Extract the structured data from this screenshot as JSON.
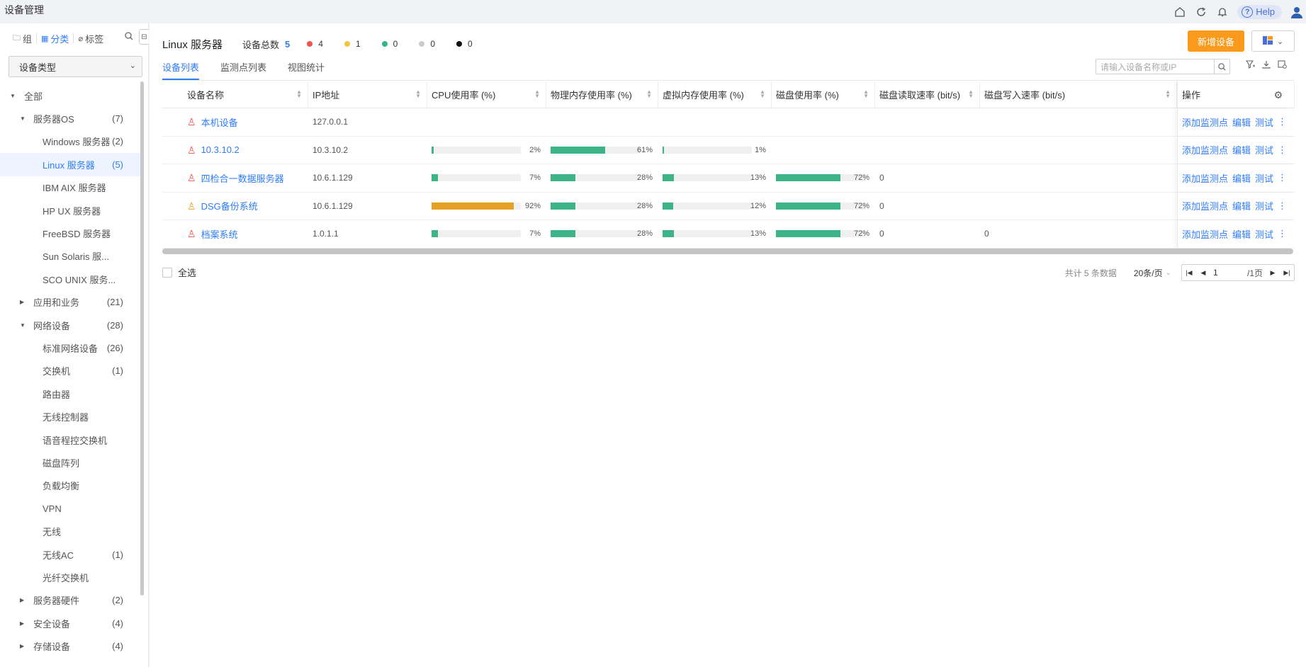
{
  "app": {
    "title": "设备管理",
    "help_label": "Help"
  },
  "colors": {
    "accent": "#2f7df6",
    "orange": "#fa9a1c",
    "green": "#3cb487",
    "cpu_high": "#e6a023",
    "red": "#ef5350",
    "yellow": "#f5c242",
    "teal": "#2fb58a",
    "grey": "#cccccc",
    "black": "#111111"
  },
  "sidebar": {
    "tabs": [
      {
        "icon": "folder-icon",
        "label": "组"
      },
      {
        "icon": "grid-icon",
        "label": "分类"
      },
      {
        "icon": "tag-icon",
        "label": "标签"
      }
    ],
    "select_value": "设备类型",
    "tree": [
      {
        "level": 0,
        "label": "全部",
        "count": "",
        "expanded": true
      },
      {
        "level": 1,
        "label": "服务器OS",
        "count": "(7)",
        "expanded": true
      },
      {
        "level": 2,
        "label": "Windows 服务器",
        "count": "(2)"
      },
      {
        "level": 2,
        "label": "Linux 服务器",
        "count": "(5)",
        "selected": true
      },
      {
        "level": 2,
        "label": "IBM AIX 服务器",
        "count": ""
      },
      {
        "level": 2,
        "label": "HP UX 服务器",
        "count": ""
      },
      {
        "level": 2,
        "label": "FreeBSD 服务器",
        "count": ""
      },
      {
        "level": 2,
        "label": "Sun Solaris 服...",
        "count": ""
      },
      {
        "level": 2,
        "label": "SCO UNIX 服务...",
        "count": ""
      },
      {
        "level": 1,
        "label": "应用和业务",
        "count": "(21)",
        "expanded": false
      },
      {
        "level": 1,
        "label": "网络设备",
        "count": "(28)",
        "expanded": true
      },
      {
        "level": 2,
        "label": "标准网络设备",
        "count": "(26)"
      },
      {
        "level": 2,
        "label": "交换机",
        "count": "(1)"
      },
      {
        "level": 2,
        "label": "路由器",
        "count": ""
      },
      {
        "level": 2,
        "label": "无线控制器",
        "count": ""
      },
      {
        "level": 2,
        "label": "语音程控交换机",
        "count": ""
      },
      {
        "level": 2,
        "label": "磁盘阵列",
        "count": ""
      },
      {
        "level": 2,
        "label": "负载均衡",
        "count": ""
      },
      {
        "level": 2,
        "label": "VPN",
        "count": ""
      },
      {
        "level": 2,
        "label": "无线",
        "count": ""
      },
      {
        "level": 2,
        "label": "无线AC",
        "count": "(1)"
      },
      {
        "level": 2,
        "label": "光纤交换机",
        "count": ""
      },
      {
        "level": 1,
        "label": "服务器硬件",
        "count": "(2)",
        "expanded": false
      },
      {
        "level": 1,
        "label": "安全设备",
        "count": "(4)",
        "expanded": false
      },
      {
        "level": 1,
        "label": "存储设备",
        "count": "(4)",
        "expanded": false
      }
    ]
  },
  "header": {
    "page_title": "Linux 服务器",
    "total_label": "设备总数",
    "total_value": "5",
    "stats": [
      {
        "color": "#ef5350",
        "value": "4"
      },
      {
        "color": "#f5c242",
        "value": "1"
      },
      {
        "color": "#2fb58a",
        "value": "0"
      },
      {
        "color": "#cccccc",
        "value": "0"
      },
      {
        "color": "#111111",
        "value": "0"
      }
    ],
    "add_button": "新增设备"
  },
  "tabs": [
    {
      "label": "设备列表",
      "active": true
    },
    {
      "label": "监测点列表",
      "active": false
    },
    {
      "label": "视图统计",
      "active": false
    }
  ],
  "search": {
    "placeholder": "请输入设备名称或IP"
  },
  "table": {
    "columns": [
      "设备名称",
      "IP地址",
      "CPU使用率 (%)",
      "物理内存使用率 (%)",
      "虚拟内存使用率 (%)",
      "磁盘使用率 (%)",
      "磁盘读取速率 (bit/s)",
      "磁盘写入速率 (bit/s)",
      "操作"
    ],
    "rows": [
      {
        "name": "本机设备",
        "status": "red",
        "ip": "127.0.0.1",
        "cpu": null,
        "mem": null,
        "vmem": null,
        "disk": null,
        "read": "",
        "write": ""
      },
      {
        "name": "10.3.10.2",
        "status": "red",
        "ip": "10.3.10.2",
        "cpu": 2,
        "mem": 61,
        "vmem": 1,
        "disk": null,
        "read": "",
        "write": ""
      },
      {
        "name": "四检合一数据服务器",
        "status": "red",
        "ip": "10.6.1.129",
        "cpu": 7,
        "mem": 28,
        "vmem": 13,
        "disk": 72,
        "read": "0",
        "write": ""
      },
      {
        "name": "DSG备份系统",
        "status": "orange",
        "ip": "10.6.1.129",
        "cpu": 92,
        "mem": 28,
        "vmem": 12,
        "disk": 72,
        "read": "0",
        "write": ""
      },
      {
        "name": "档案系统",
        "status": "red",
        "ip": "1.0.1.1",
        "cpu": 7,
        "mem": 28,
        "vmem": 13,
        "disk": 72,
        "read": "0",
        "write": "0"
      }
    ],
    "actions": [
      "添加监测点",
      "编辑",
      "测试"
    ]
  },
  "footer": {
    "select_all": "全选",
    "total_text": "共计 5 条数据",
    "per_page": "20条/页",
    "page_value": "1",
    "page_total": "/1页"
  }
}
